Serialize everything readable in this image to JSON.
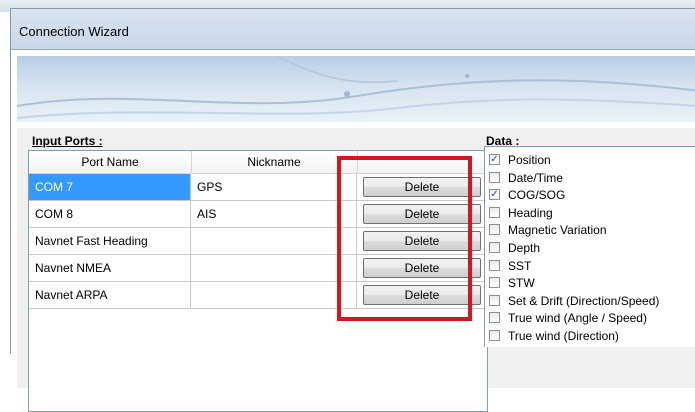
{
  "window": {
    "title": "Connection Wizard"
  },
  "input_ports": {
    "label": "Input Ports :",
    "columns": [
      "Port Name",
      "Nickname"
    ],
    "rows": [
      {
        "port": "COM 7",
        "nickname": "GPS",
        "action": "Delete",
        "selected": true
      },
      {
        "port": "COM 8",
        "nickname": "AIS",
        "action": "Delete",
        "selected": false
      },
      {
        "port": "Navnet Fast Heading",
        "nickname": "",
        "action": "Delete",
        "selected": false
      },
      {
        "port": "Navnet NMEA",
        "nickname": "",
        "action": "Delete",
        "selected": false
      },
      {
        "port": "Navnet ARPA",
        "nickname": "",
        "action": "Delete",
        "selected": false
      }
    ]
  },
  "data_section": {
    "label": "Data :",
    "items": [
      {
        "label": "Position",
        "checked": true
      },
      {
        "label": "Date/Time",
        "checked": false
      },
      {
        "label": "COG/SOG",
        "checked": true
      },
      {
        "label": "Heading",
        "checked": false
      },
      {
        "label": "Magnetic Variation",
        "checked": false
      },
      {
        "label": "Depth",
        "checked": false
      },
      {
        "label": "SST",
        "checked": false
      },
      {
        "label": "STW",
        "checked": false
      },
      {
        "label": "Set & Drift (Direction/Speed)",
        "checked": false
      },
      {
        "label": "True wind (Angle / Speed)",
        "checked": false
      },
      {
        "label": "True wind (Direction)",
        "checked": false
      }
    ]
  },
  "colors": {
    "highlight": "#d4161f",
    "selection": "#3399ff"
  }
}
